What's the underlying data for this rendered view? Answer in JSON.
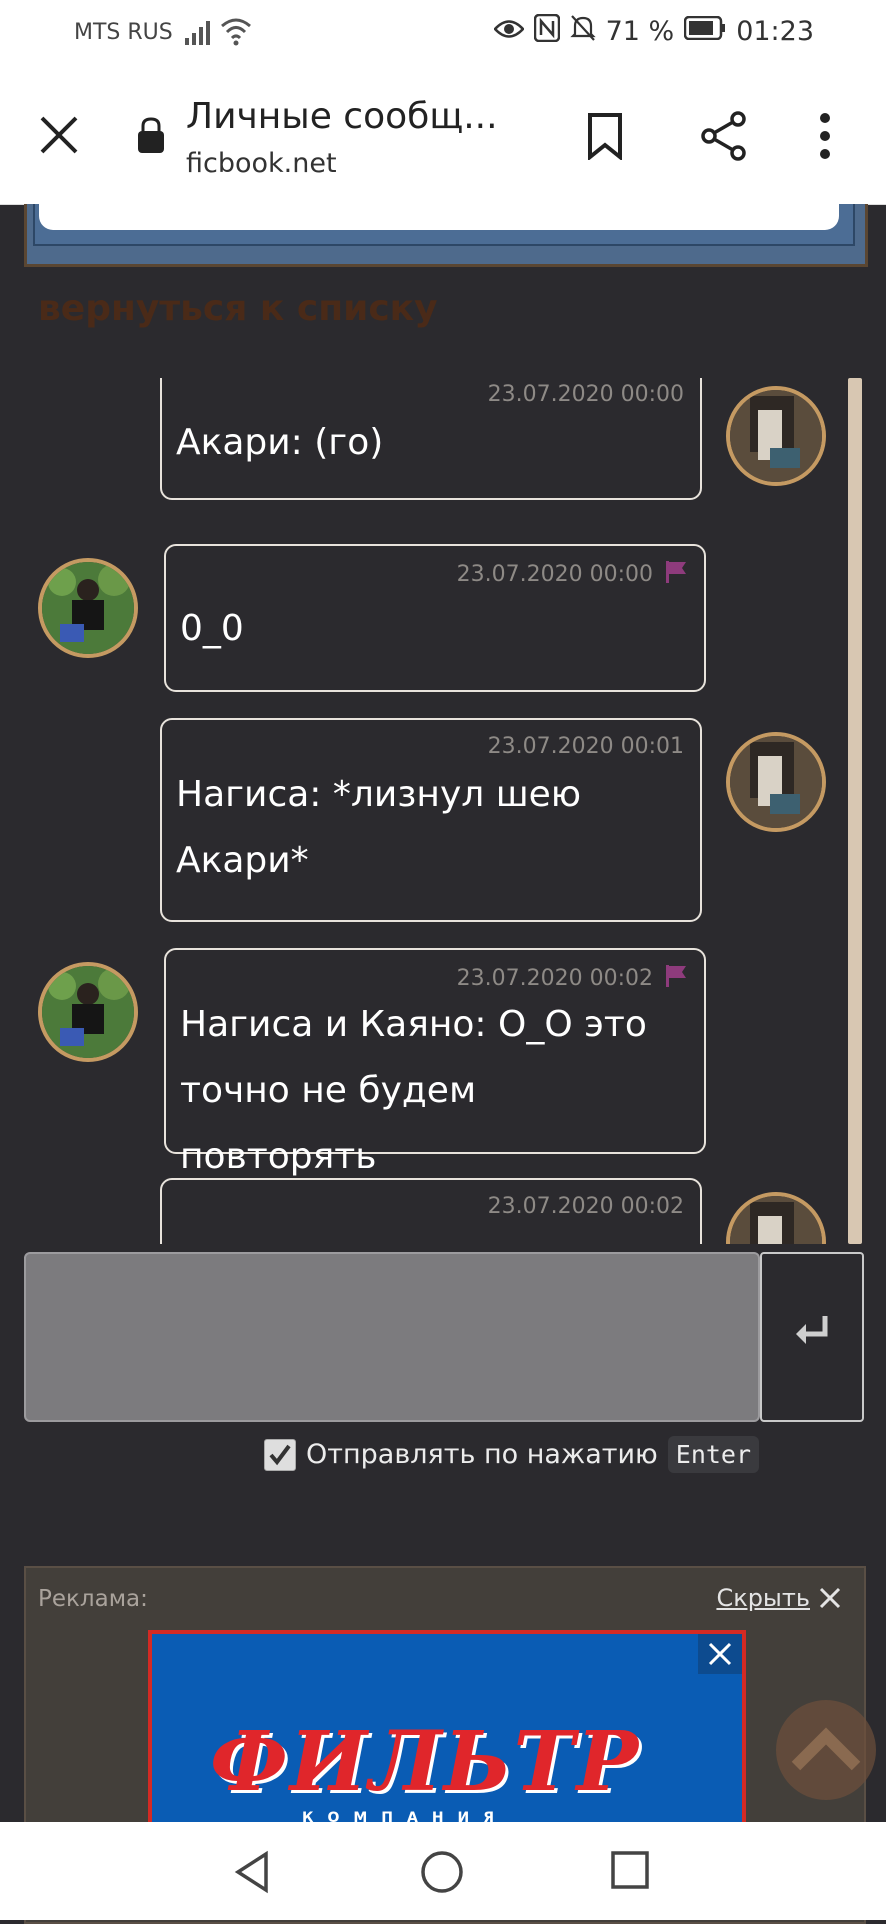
{
  "status_bar": {
    "carrier": "MTS RUS",
    "battery": "71 %",
    "time": "01:23"
  },
  "browser": {
    "title": "Личные сообщ...",
    "url": "ficbook.net"
  },
  "page": {
    "back_link": "вернуться к списку"
  },
  "messages": [
    {
      "side": "right",
      "time": "23.07.2020 00:00",
      "text": "Акари: (го)",
      "flag": false
    },
    {
      "side": "left",
      "time": "23.07.2020 00:00",
      "text": "0_0",
      "flag": true
    },
    {
      "side": "right",
      "time": "23.07.2020 00:01",
      "text": "Нагиса: *лизнул шею Акари*",
      "flag": false
    },
    {
      "side": "left",
      "time": "23.07.2020 00:02",
      "text": "Нагиса и Каяно: О_О это точно не будем повторять",
      "flag": true
    },
    {
      "side": "right",
      "time": "23.07.2020 00:02",
      "text": "",
      "flag": false
    }
  ],
  "composer": {
    "send_on_enter_label": "Отправлять по нажатию",
    "enter_key": "Enter",
    "send_on_enter_checked": true
  },
  "ad": {
    "label": "Реклама:",
    "hide": "Скрыть",
    "brand": "ФИЛЬТР",
    "brand_sub": "КОМПАНИЯ"
  },
  "colors": {
    "page_bg": "#2b2a2e",
    "avatar_border": "#c59a62",
    "flag": "#8e3b7c",
    "back_link": "#4a2a18"
  }
}
